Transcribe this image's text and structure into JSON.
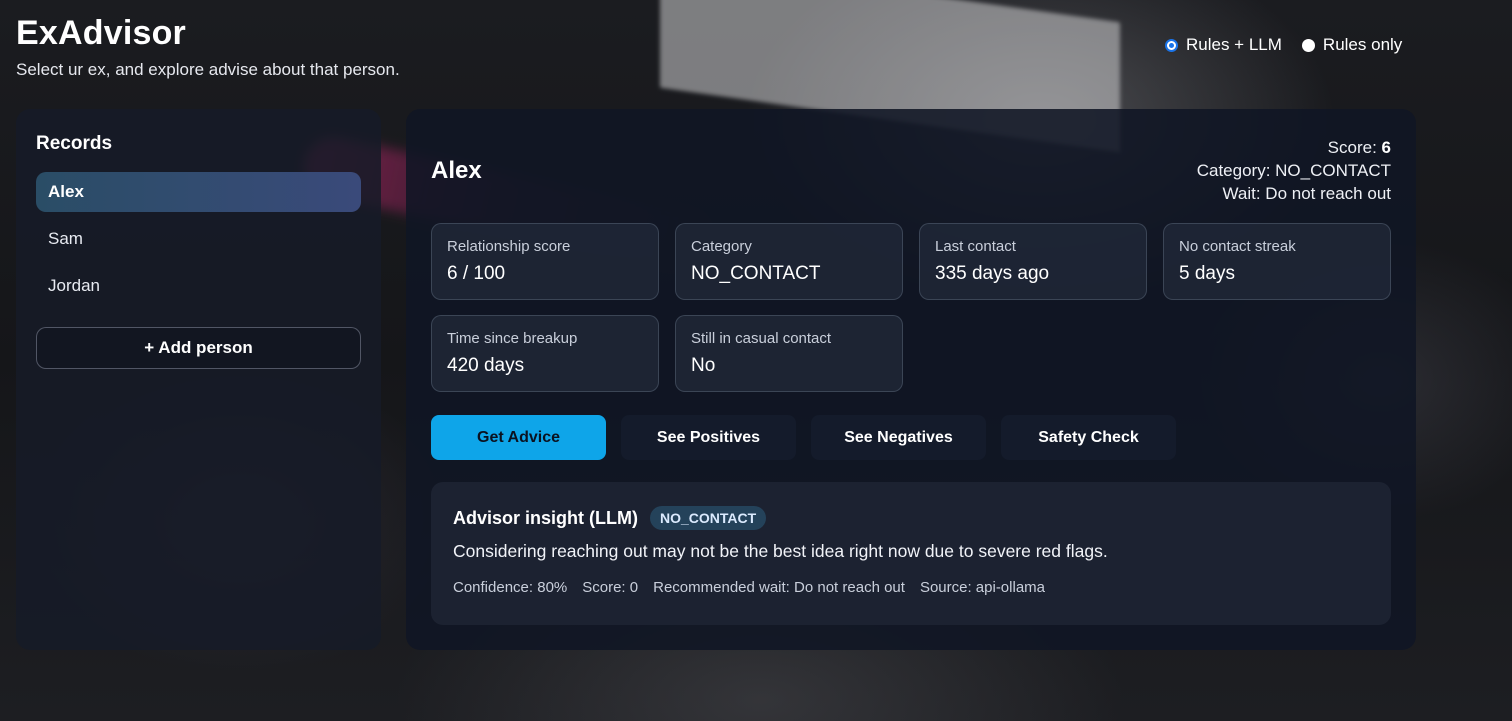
{
  "app": {
    "title": "ExAdvisor",
    "subtitle": "Select ur ex, and explore advise about that person."
  },
  "mode": {
    "options": [
      {
        "label": "Rules + LLM",
        "checked": true
      },
      {
        "label": "Rules only",
        "checked": false
      }
    ]
  },
  "sidebar": {
    "title": "Records",
    "items": [
      {
        "label": "Alex",
        "selected": true
      },
      {
        "label": "Sam",
        "selected": false
      },
      {
        "label": "Jordan",
        "selected": false
      }
    ],
    "add_label": "+ Add person"
  },
  "person": {
    "name": "Alex",
    "summary": {
      "score_label": "Score:",
      "score_value": "6",
      "category_line": "Category: NO_CONTACT",
      "wait_line": "Wait: Do not reach out"
    },
    "stats": [
      {
        "label": "Relationship score",
        "value": "6 / 100"
      },
      {
        "label": "Category",
        "value": "NO_CONTACT"
      },
      {
        "label": "Last contact",
        "value": "335 days ago"
      },
      {
        "label": "No contact streak",
        "value": "5 days"
      },
      {
        "label": "Time since breakup",
        "value": "420 days"
      },
      {
        "label": "Still in casual contact",
        "value": "No"
      }
    ]
  },
  "actions": {
    "get_advice": "Get Advice",
    "see_positives": "See Positives",
    "see_negatives": "See Negatives",
    "safety_check": "Safety Check"
  },
  "insight": {
    "title": "Advisor insight (LLM)",
    "badge": "NO_CONTACT",
    "text": "Considering reaching out may not be the best idea right now due to severe red flags.",
    "meta": {
      "confidence": "Confidence: 80%",
      "score": "Score: 0",
      "wait": "Recommended wait: Do not reach out",
      "source": "Source: api-ollama"
    }
  },
  "colors": {
    "accent": "#0ea5e9",
    "radio_checked": "#1a73e8",
    "selected_item": "#2a4d66",
    "badge_bg": "#24425a"
  }
}
